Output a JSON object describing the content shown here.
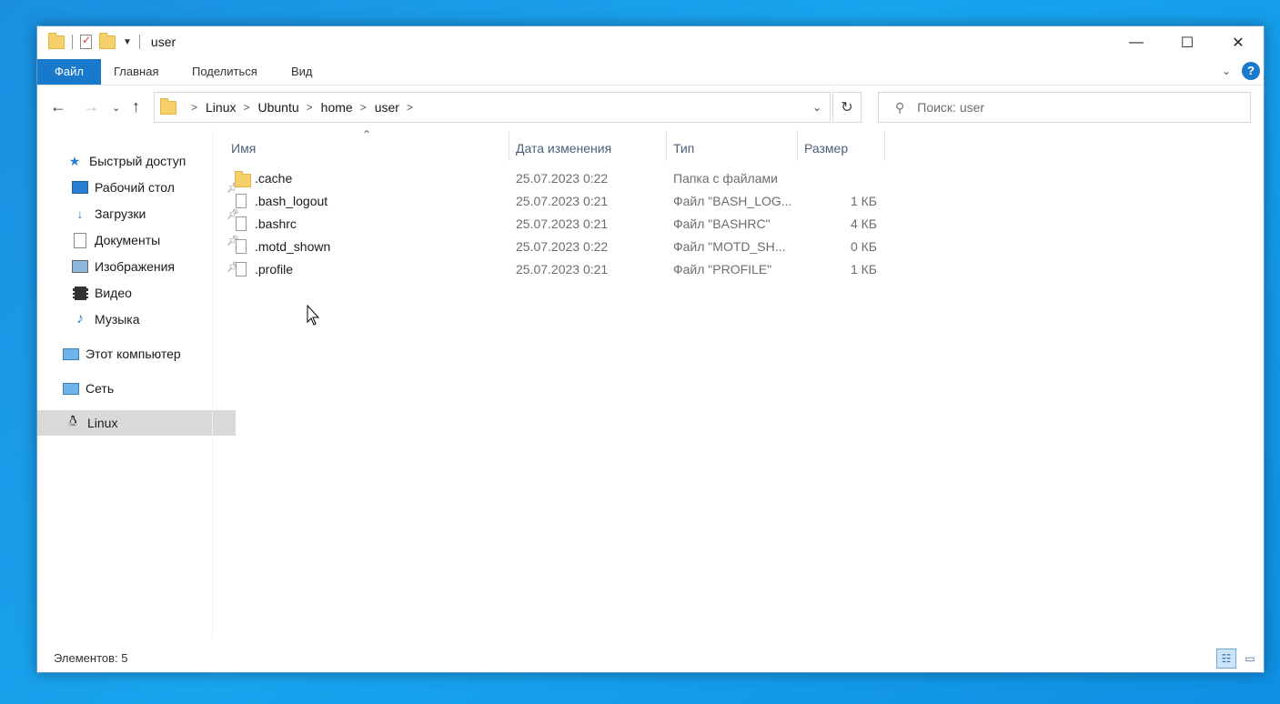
{
  "window": {
    "title": "user",
    "controls": {
      "minimize": "—",
      "maximize": "☐",
      "close": "✕"
    }
  },
  "ribbon": {
    "tabs": [
      "Файл",
      "Главная",
      "Поделиться",
      "Вид"
    ],
    "help_label": "?"
  },
  "address": {
    "crumbs": [
      "Linux",
      "Ubuntu",
      "home",
      "user"
    ]
  },
  "search": {
    "placeholder": "Поиск: user"
  },
  "sidebar": {
    "quick_access": "Быстрый доступ",
    "items": [
      {
        "label": "Рабочий стол",
        "icon": "desktop-icon",
        "pinned": true
      },
      {
        "label": "Загрузки",
        "icon": "downloads-icon",
        "pinned": true
      },
      {
        "label": "Документы",
        "icon": "documents-icon",
        "pinned": true
      },
      {
        "label": "Изображения",
        "icon": "pictures-icon",
        "pinned": true
      },
      {
        "label": "Видео",
        "icon": "videos-icon",
        "pinned": false
      },
      {
        "label": "Музыка",
        "icon": "music-icon",
        "pinned": false
      }
    ],
    "this_pc": "Этот компьютер",
    "network": "Сеть",
    "linux": "Linux"
  },
  "columns": {
    "name": "Имя",
    "date": "Дата изменения",
    "type": "Тип",
    "size": "Размер"
  },
  "files": [
    {
      "name": ".cache",
      "date": "25.07.2023 0:22",
      "type": "Папка с файлами",
      "size": "",
      "is_folder": true
    },
    {
      "name": ".bash_logout",
      "date": "25.07.2023 0:21",
      "type": "Файл \"BASH_LOG...",
      "size": "1 КБ",
      "is_folder": false
    },
    {
      "name": ".bashrc",
      "date": "25.07.2023 0:21",
      "type": "Файл \"BASHRC\"",
      "size": "4 КБ",
      "is_folder": false
    },
    {
      "name": ".motd_shown",
      "date": "25.07.2023 0:22",
      "type": "Файл \"MOTD_SH...",
      "size": "0 КБ",
      "is_folder": false
    },
    {
      "name": ".profile",
      "date": "25.07.2023 0:21",
      "type": "Файл \"PROFILE\"",
      "size": "1 КБ",
      "is_folder": false
    }
  ],
  "status": {
    "items_count": "Элементов: 5"
  },
  "colors": {
    "accent": "#1979ca",
    "folder": "#f5d06b",
    "selected": "#d9d9d9"
  }
}
